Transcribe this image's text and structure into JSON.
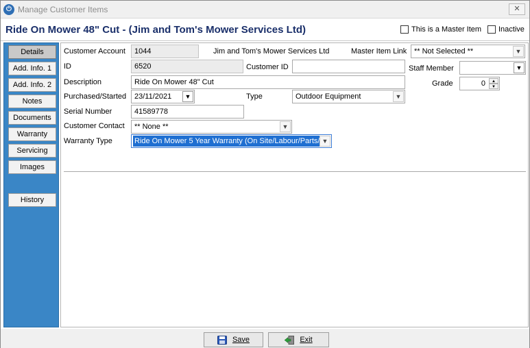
{
  "window": {
    "title": "Manage Customer Items",
    "close_label": "✕"
  },
  "header": {
    "title": "Ride On Mower 48\" Cut - (Jim and Tom's Mower Services Ltd)",
    "master_item_label": "This is a Master Item",
    "inactive_label": "Inactive"
  },
  "sidebar": {
    "items": [
      {
        "label": "Details"
      },
      {
        "label": "Add. Info. 1"
      },
      {
        "label": "Add. Info. 2"
      },
      {
        "label": "Notes"
      },
      {
        "label": "Documents"
      },
      {
        "label": "Warranty"
      },
      {
        "label": "Servicing"
      },
      {
        "label": "Images"
      },
      {
        "label": "History"
      }
    ]
  },
  "form": {
    "customer_account_label": "Customer Account",
    "customer_account_value": "1044",
    "customer_name": "Jim and Tom's Mower Services Ltd",
    "master_item_link_label": "Master Item Link",
    "master_item_link_value": "** Not Selected **",
    "id_label": "ID",
    "id_value": "6520",
    "customer_id_label": "Customer ID",
    "customer_id_value": "",
    "staff_member_label": "Staff Member",
    "staff_member_value": "",
    "description_label": "Description",
    "description_value": "Ride On Mower 48\" Cut",
    "grade_label": "Grade",
    "grade_value": "0",
    "purchased_label": "Purchased/Started",
    "purchased_value": "23/11/2021",
    "type_label": "Type",
    "type_value": "Outdoor Equipment",
    "serial_label": "Serial Number",
    "serial_value": "41589778",
    "contact_label": "Customer Contact",
    "contact_value": "** None **",
    "warranty_type_label": "Warranty Type",
    "warranty_type_value": "Ride On Mower 5 Year Warranty (On Site/Labour/Parts/"
  },
  "footer": {
    "save_label": "Save",
    "exit_label": "Exit"
  },
  "colors": {
    "sidebar": "#3a86c6",
    "title": "#1a2f6a",
    "selection": "#1f6fd1"
  }
}
